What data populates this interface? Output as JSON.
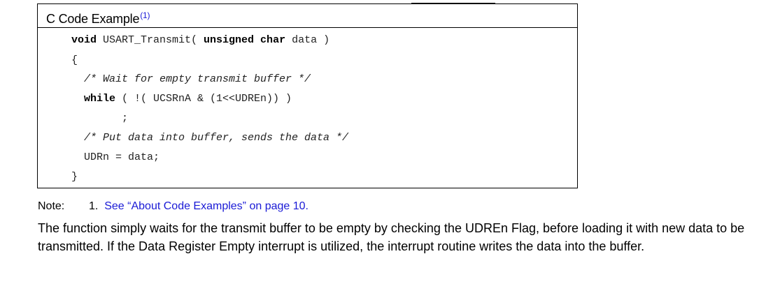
{
  "box": {
    "title": "C Code Example",
    "footnote_ref": "(1)"
  },
  "code": {
    "line1": {
      "kw1": "void",
      "rest1": " USART_Transmit( ",
      "kw2": "unsigned char",
      "rest2": " data )"
    },
    "line2": "{",
    "line3": "/* Wait for empty transmit buffer */",
    "line4": {
      "kw": "while",
      "rest": " ( !( UCSRnA & (1<<UDREn)) )"
    },
    "line5": ";",
    "line6": "/* Put data into buffer, sends the data */",
    "line7": "UDRn = data;",
    "line8": "}"
  },
  "note": {
    "label": "Note:",
    "number": "1.",
    "link_text": "See “About Code Examples” on page 10."
  },
  "paragraph": "The function simply waits for the transmit buffer to be empty by checking the UDREn Flag, before loading it with new data to be transmitted. If the Data Register Empty interrupt is utilized, the interrupt routine writes the data into the buffer."
}
